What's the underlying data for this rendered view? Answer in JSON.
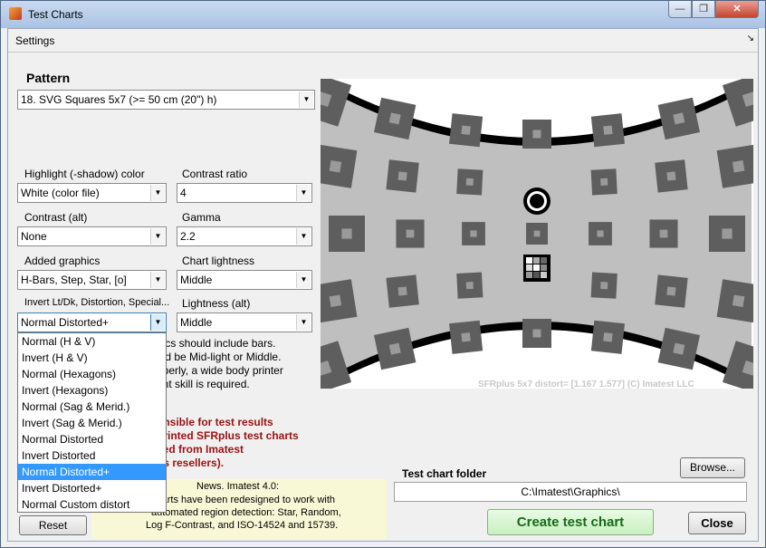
{
  "window": {
    "title": "Test Charts",
    "min": "—",
    "max": "❐",
    "close": "✕"
  },
  "settings": {
    "label": "Settings",
    "dock": "↘"
  },
  "pattern": {
    "title": "Pattern",
    "value": "18. SVG Squares 5x7 (>= 50 cm (20\") h)"
  },
  "fields": {
    "highlight": {
      "label": "Highlight (-shadow) color",
      "value": "White  (color file)"
    },
    "contrast_ratio": {
      "label": "Contrast ratio",
      "value": "4"
    },
    "contrast_alt": {
      "label": "Contrast (alt)",
      "value": "None"
    },
    "gamma": {
      "label": "Gamma",
      "value": "2.2"
    },
    "added_graphics": {
      "label": "Added graphics",
      "value": "H-Bars, Step, Star, [o]"
    },
    "chart_lightness": {
      "label": "Chart lightness",
      "value": "Middle"
    },
    "invert": {
      "label": "Invert Lt/Dk, Distortion, Special...",
      "value": "Normal Distorted+"
    },
    "lightness_alt": {
      "label": "Lightness (alt)",
      "value": "Middle"
    }
  },
  "dropdown_list": {
    "items": [
      "Normal (H & V)",
      "Invert    (H & V)",
      "Normal (Hexagons)",
      "Invert    (Hexagons)",
      "Normal (Sag & Merid.)",
      "Invert    (Sag & Merid.)",
      "Normal Distorted",
      "Invert    Distorted",
      "Normal Distorted+",
      "Invert    Distorted+",
      "Normal Custom distort"
    ],
    "selected_index": 8
  },
  "chart": {
    "caption": "SFRplus 5x7   distort= [1.167  1.577]   (C) Imatest LLC"
  },
  "note": [
    "hics should include bars.",
    "uld be Mid-light or Middle.",
    "pperly, a wide body printer",
    "ent skill is required."
  ],
  "warning": [
    "onsible for test results",
    "printed SFRplus test charts",
    "sed from Imatest",
    "its resellers)."
  ],
  "news": [
    "News.   Imatest 4.0:",
    "charts have been redesigned to work with",
    "automated region detection:  Star, Random,",
    "Log F-Contrast, and  ISO-14524 and 15739."
  ],
  "buttons": {
    "reset": "Reset",
    "browse": "Browse...",
    "create": "Create test chart",
    "close": "Close"
  },
  "folder": {
    "label": "Test chart folder",
    "value": "C:\\Imatest\\Graphics\\"
  },
  "colors": {
    "selection": "#3399ff",
    "create_text": "#176b17",
    "warning": "#9a1212"
  }
}
